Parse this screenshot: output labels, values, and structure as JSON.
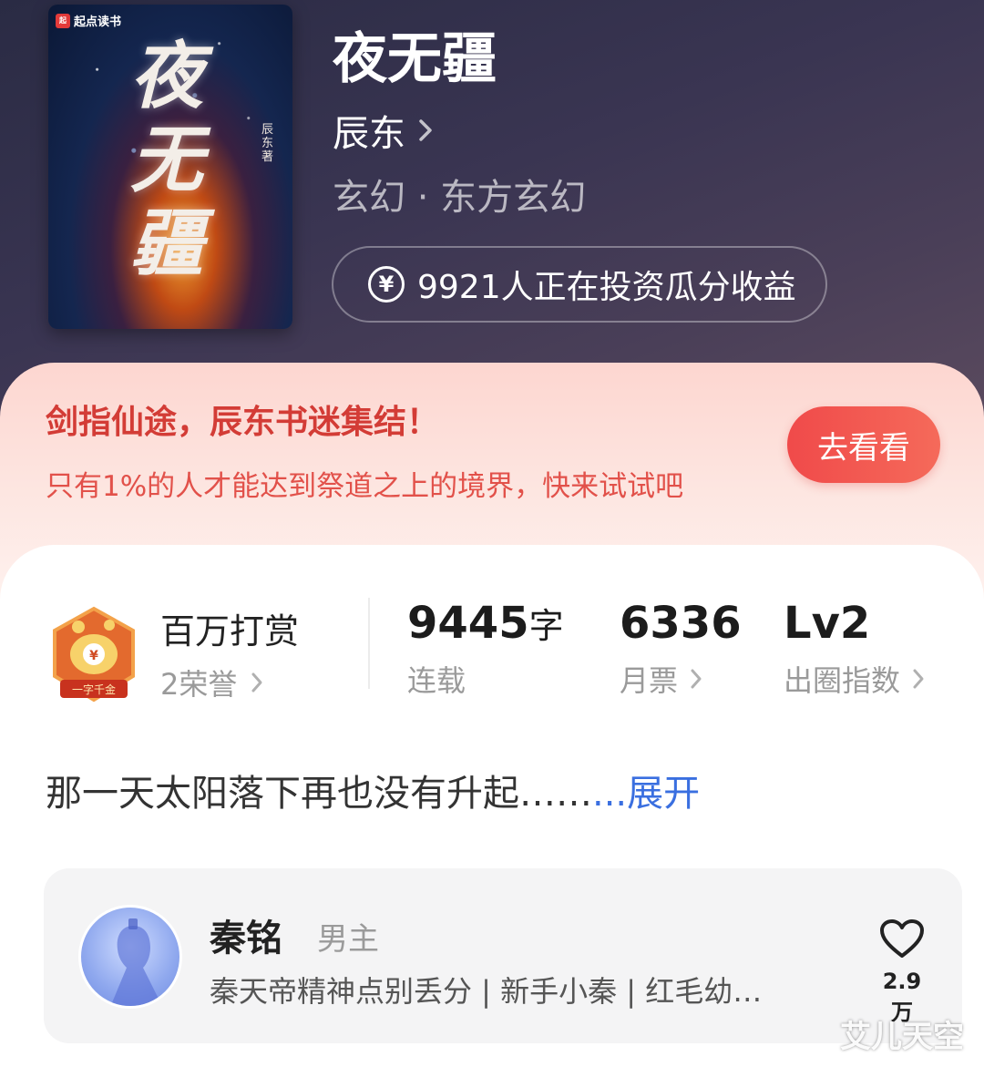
{
  "book": {
    "cover_brand": "起点读书",
    "cover_title": "夜无疆",
    "cover_author": "辰东著",
    "title": "夜无疆",
    "author": "辰东",
    "genre": "玄幻 · 东方玄幻",
    "invest_text": "9921人正在投资瓜分收益"
  },
  "promo": {
    "title": "剑指仙途，辰东书迷集结！",
    "subtitle": "只有1%的人才能达到祭道之上的境界，快来试试吧",
    "button": "去看看"
  },
  "stats": {
    "honor_title": "百万打赏",
    "honor_count": "2荣誉",
    "badge_text": "一字千金",
    "words_value": "9445",
    "words_unit": "字",
    "words_label": "连载",
    "monthly_value": "6336",
    "monthly_label": "月票",
    "level_value": "Lv2",
    "level_label": "出圈指数"
  },
  "synopsis": {
    "text": "那一天太阳落下再也没有升起……",
    "more": "...展开"
  },
  "character": {
    "name": "秦铭",
    "role": "男主",
    "tags": "秦天帝精神点别丢分 | 新手小秦 | 红毛幼…",
    "likes": "2.9万"
  },
  "watermark": "艾儿天空"
}
